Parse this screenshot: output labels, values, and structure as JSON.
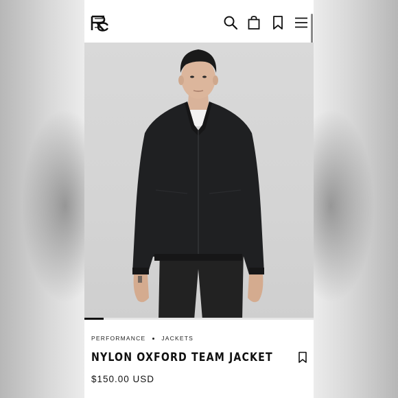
{
  "header": {
    "logo_icon": "rc-monogram-logo-icon",
    "search_icon": "search-icon",
    "bag_icon": "shopping-bag-icon",
    "wishlist_icon": "bookmark-icon",
    "menu_icon": "hamburger-menu-icon"
  },
  "gallery": {
    "image": "product-photo-model-wearing-black-jacket",
    "active_slide_index": 1
  },
  "product": {
    "breadcrumb": [
      "PERFORMANCE",
      "JACKETS"
    ],
    "title": "NYLON OXFORD TEAM JACKET",
    "price": "$150.00 USD",
    "save_icon": "bookmark-icon"
  },
  "colors": {
    "text": "#111111",
    "background": "#ffffff",
    "photo_background": "#d6d6d6"
  }
}
